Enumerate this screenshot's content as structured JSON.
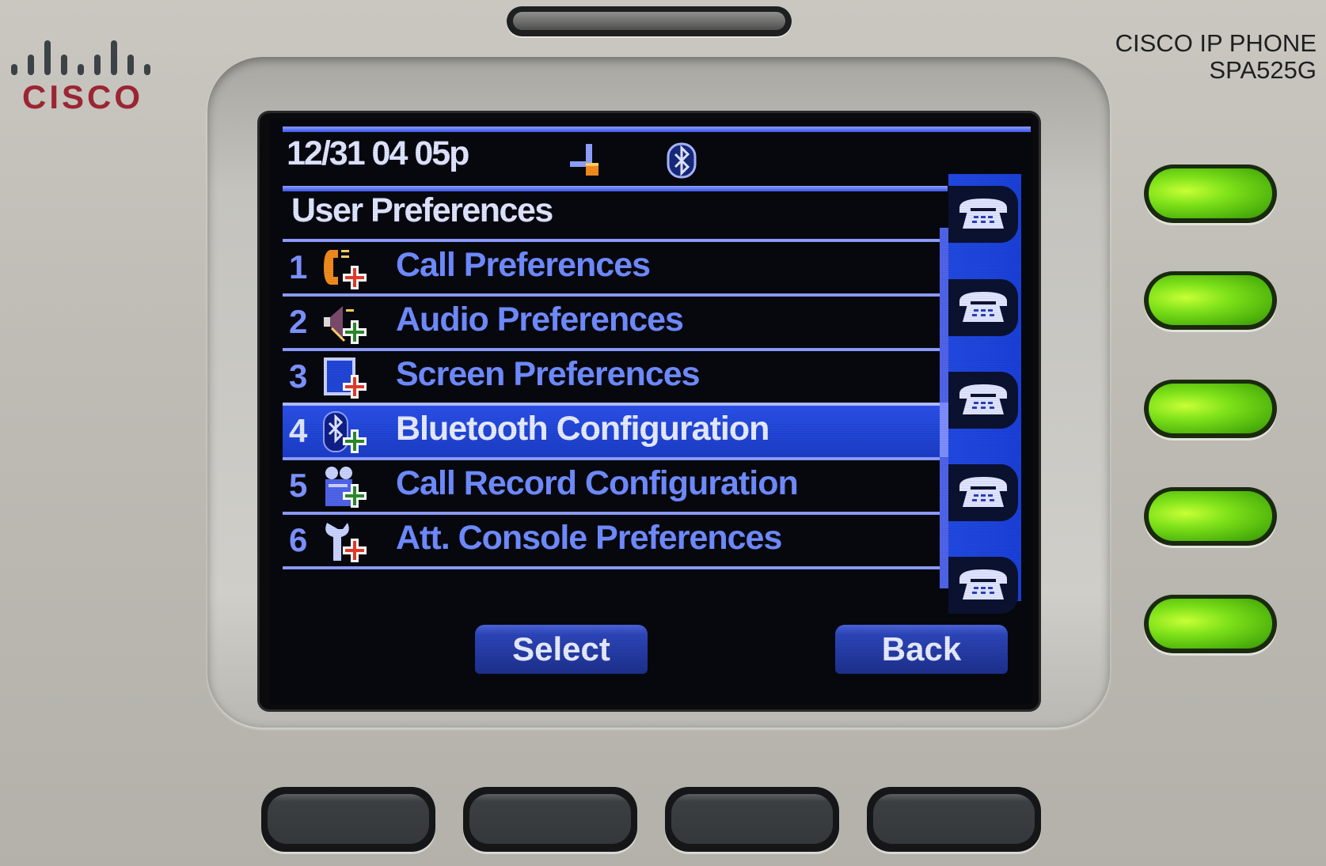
{
  "device": {
    "brand": "CISCO",
    "model_line1": "CISCO IP PHONE",
    "model_line2": "SPA525G"
  },
  "status_bar": {
    "datetime": "12/31 04 05p",
    "icons": [
      "network-icon",
      "bluetooth-icon"
    ]
  },
  "screen": {
    "title": "User Preferences",
    "selected_index": 3,
    "menu_items": [
      {
        "number": "1",
        "label": "Call Preferences",
        "icon": "call-preferences-icon"
      },
      {
        "number": "2",
        "label": "Audio Preferences",
        "icon": "audio-preferences-icon"
      },
      {
        "number": "3",
        "label": "Screen Preferences",
        "icon": "screen-preferences-icon"
      },
      {
        "number": "4",
        "label": "Bluetooth Configuration",
        "icon": "bluetooth-config-icon"
      },
      {
        "number": "5",
        "label": "Call Record Configuration",
        "icon": "call-record-icon"
      },
      {
        "number": "6",
        "label": "Att. Console Preferences",
        "icon": "console-preferences-icon"
      }
    ],
    "line_keys_count": 5,
    "softkeys": {
      "select": "Select",
      "back": "Back"
    }
  },
  "hardware": {
    "line_key_color": "#7fe21a",
    "line_keys": 5,
    "soft_keys": 4
  },
  "colors": {
    "screen_bg": "#07080e",
    "accent_blue": "#2146d6",
    "text_blue": "#6f8bff",
    "logo_red": "#9b2533"
  }
}
